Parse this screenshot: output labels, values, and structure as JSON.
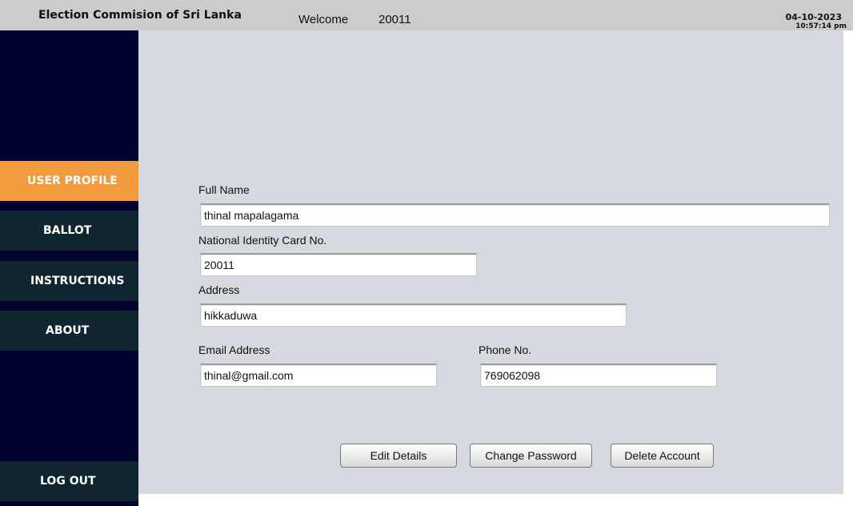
{
  "header": {
    "app_title": "Election Commision of Sri Lanka",
    "welcome_label": "Welcome",
    "user_id": "20011",
    "date": "04-10-2023",
    "time": "10:57:14 pm"
  },
  "sidebar": {
    "items": [
      {
        "label": "USER PROFILE",
        "active": true
      },
      {
        "label": "BALLOT",
        "active": false
      },
      {
        "label": "INSTRUCTIONS",
        "active": false
      },
      {
        "label": "ABOUT",
        "active": false
      }
    ],
    "logout_label": "LOG OUT"
  },
  "form": {
    "full_name": {
      "label": "Full Name",
      "value": "thinal mapalagama"
    },
    "nic": {
      "label": "National Identity Card No.",
      "value": "20011"
    },
    "address": {
      "label": "Address",
      "value": "hikkaduwa"
    },
    "email": {
      "label": "Email Address",
      "value": "thinal@gmail.com"
    },
    "phone": {
      "label": "Phone No.",
      "value": "769062098"
    }
  },
  "actions": {
    "edit_label": "Edit Details",
    "change_password_label": "Change Password",
    "delete_label": "Delete Account"
  },
  "colors": {
    "sidebar_bg": "#01012d",
    "nav_item_bg": "#0f2530",
    "active_accent": "#f29a3e",
    "content_bg": "#d6d9df",
    "header_bg": "#cccccc"
  }
}
